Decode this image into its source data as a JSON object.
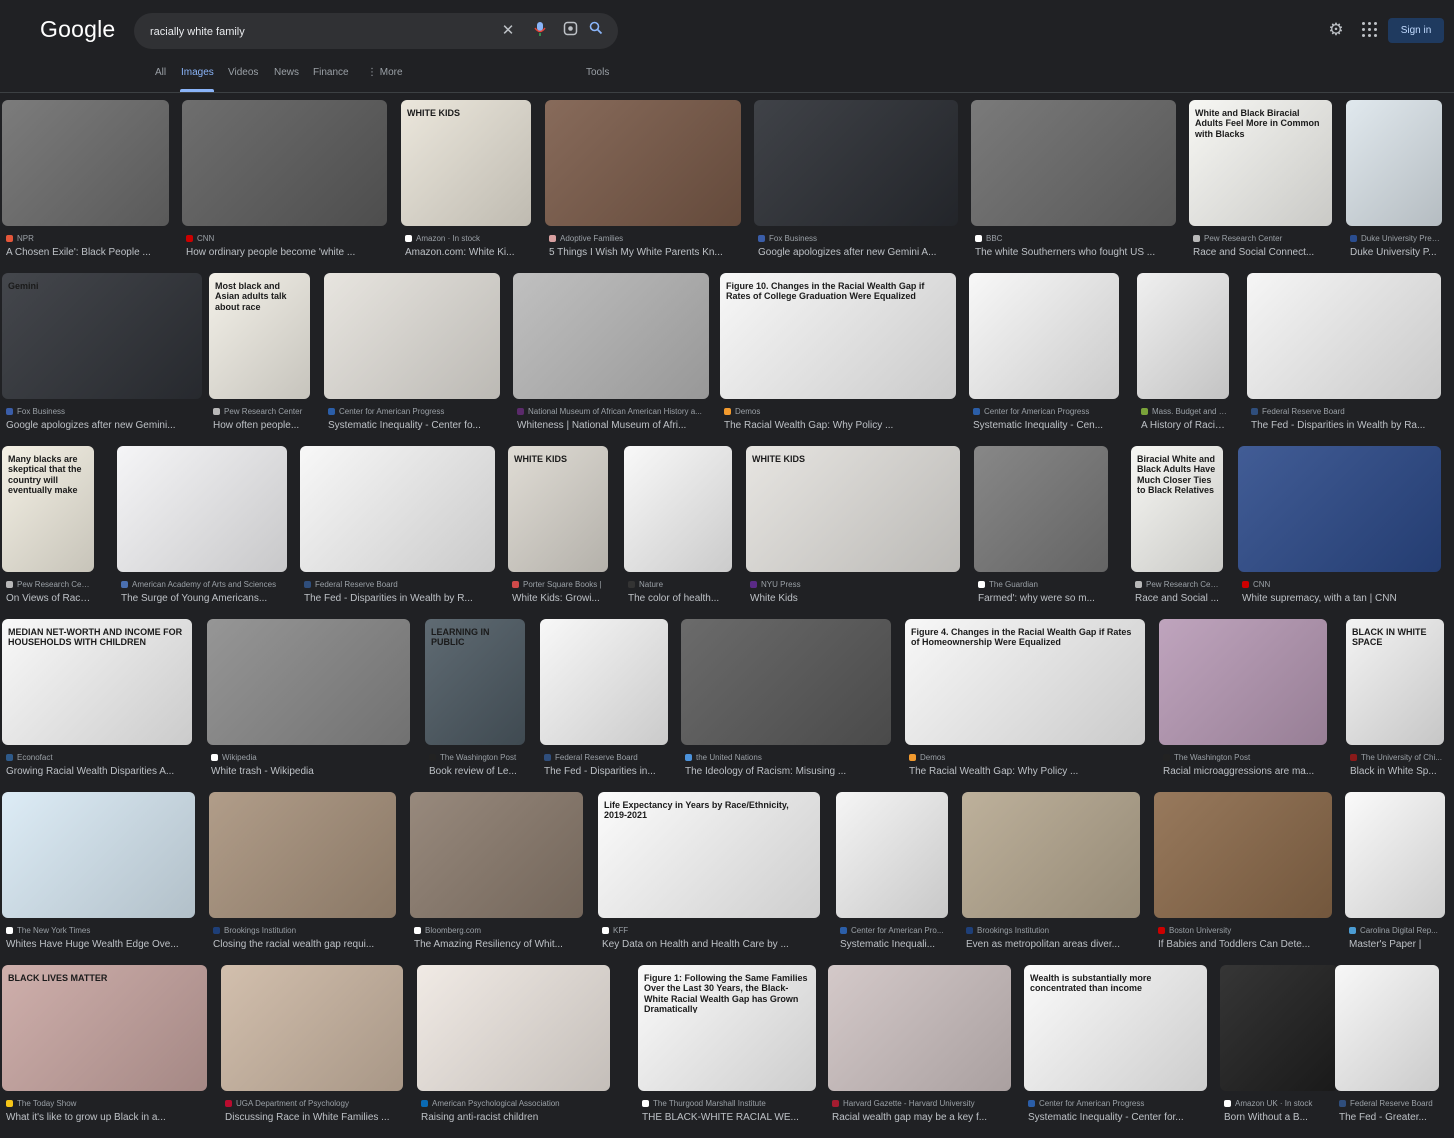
{
  "header": {
    "logo": "Google",
    "query": "racially white family",
    "signin": "Sign in"
  },
  "icons": [
    "clear-icon",
    "mic-icon",
    "lens-icon",
    "search-icon",
    "settings-gear-icon",
    "apps-grid-icon"
  ],
  "tabs": [
    {
      "label": "All"
    },
    {
      "label": "Images",
      "active": true
    },
    {
      "label": "Videos"
    },
    {
      "label": "News"
    },
    {
      "label": "Finance"
    },
    {
      "label": "⋮ More"
    },
    {
      "label": "Tools"
    }
  ],
  "results": [
    {
      "source": "NPR",
      "title": "A Chosen Exile': Black People ...",
      "color": "#6d6d6d",
      "fav": "#e4563a"
    },
    {
      "source": "CNN",
      "title": "How ordinary people become 'white ...",
      "color": "#5e5e5e",
      "fav": "#cc0000"
    },
    {
      "source": "Amazon · In stock",
      "title": "Amazon.com: White Ki...",
      "color": "#e9e4d8",
      "fav": "#ffffff",
      "caption": "WHITE KIDS"
    },
    {
      "source": "Adoptive Families",
      "title": "5 Things I Wish My White Parents Kn...",
      "color": "#7a5a48",
      "fav": "#d8a0a0"
    },
    {
      "source": "Fox Business",
      "title": "Google apologizes after new Gemini A...",
      "color": "#2a2d33",
      "fav": "#3a5da8"
    },
    {
      "source": "BBC",
      "title": "The white Southerners who fought US ...",
      "color": "#6b6b6b",
      "fav": "#ffffff"
    },
    {
      "source": "Pew Research Center",
      "title": "Race and Social Connect...",
      "color": "#f6f6f2",
      "fav": "#b8b8b8",
      "caption": "White and Black Biracial Adults Feel More in Common with Blacks"
    },
    {
      "source": "Duke University Pres...",
      "title": "Duke University P...",
      "color": "#dde6ec",
      "fav": "#2a4d8f"
    },
    {
      "source": "Fox Business",
      "title": "Google apologizes after new Gemini...",
      "color": "#2f3238",
      "fav": "#3a5da8",
      "caption": "Gemini"
    },
    {
      "source": "Pew Research Center",
      "title": "How often people...",
      "color": "#f2efe6",
      "fav": "#b8b8b8",
      "caption": "Most black and Asian adults talk about race"
    },
    {
      "source": "Center for American Progress",
      "title": "Systematic Inequality - Center fo...",
      "color": "#e5e2dc",
      "fav": "#2b5ea8"
    },
    {
      "source": "National Museum of African American History a...",
      "title": "Whiteness | National Museum of Afri...",
      "color": "#b9b9b9",
      "fav": "#5b2a6b"
    },
    {
      "source": "Demos",
      "title": "The Racial Wealth Gap: Why Policy ...",
      "color": "#f7f7f7",
      "fav": "#f29a2e",
      "caption": "Figure 10. Changes in the Racial Wealth Gap if Rates of College Graduation Were Equalized"
    },
    {
      "source": "Center for American Progress",
      "title": "Systematic Inequality - Cen...",
      "color": "#f7f7f7",
      "fav": "#2b5ea8"
    },
    {
      "source": "Mass. Budget and Po...",
      "title": "A History of Racis...",
      "color": "#eeeeee",
      "fav": "#7aa33a"
    },
    {
      "source": "Federal Reserve Board",
      "title": "The Fed - Disparities in Wealth by Ra...",
      "color": "#f5f5f5",
      "fav": "#2f4e7c"
    },
    {
      "source": "Pew Research Center",
      "title": "On Views of Race...",
      "color": "#f3efe2",
      "fav": "#b8b8b8",
      "caption": "Many blacks are skeptical that the country will eventually make the changes necessary for racial equality"
    },
    {
      "source": "American Academy of Arts and Sciences",
      "title": "The Surge of Young Americans...",
      "color": "#f4f4f6",
      "fav": "#4a6fb0"
    },
    {
      "source": "Federal Reserve Board",
      "title": "The Fed - Disparities in Wealth by R...",
      "color": "#f7f7f7",
      "fav": "#2f4e7c"
    },
    {
      "source": "Porter Square Books |",
      "title": "White Kids: Growi...",
      "color": "#dcd8d0",
      "fav": "#d04a4a",
      "caption": "WHITE KIDS"
    },
    {
      "source": "Nature",
      "title": "The color of health...",
      "color": "#f8f8f8",
      "fav": "#333333"
    },
    {
      "source": "NYU Press",
      "title": "White Kids",
      "color": "#e4e2de",
      "fav": "#5a2a86",
      "caption": "WHITE KIDS"
    },
    {
      "source": "The Guardian",
      "title": "Farmed': why were so m...",
      "color": "#7a7a7a",
      "fav": "#ffffff"
    },
    {
      "source": "Pew Research Center",
      "title": "Race and Social ...",
      "color": "#f6f6f2",
      "fav": "#b8b8b8",
      "caption": "Biracial White and Black Adults Have Much Closer Ties to Black Relatives"
    },
    {
      "source": "CNN",
      "title": "White supremacy, with a tan | CNN",
      "color": "#2c4a8a",
      "fav": "#cc0000"
    },
    {
      "source": "Econofact",
      "title": "Growing Racial Wealth Disparities A...",
      "color": "#f8f8f8",
      "fav": "#2e5a8a",
      "caption": "MEDIAN NET-WORTH AND INCOME FOR HOUSEHOLDS WITH CHILDREN"
    },
    {
      "source": "Wikipedia",
      "title": "White trash - Wikipedia",
      "color": "#8a8a8a",
      "fav": "#ffffff"
    },
    {
      "source": "The Washington Post",
      "title": "Book review of Le...",
      "color": "#4d5a63",
      "fav": "#222222",
      "caption": "LEARNING IN PUBLIC"
    },
    {
      "source": "Federal Reserve Board",
      "title": "The Fed - Disparities in...",
      "color": "#f7f7f7",
      "fav": "#2f4e7c"
    },
    {
      "source": "the United Nations",
      "title": "The Ideology of Racism: Misusing ...",
      "color": "#5a5a5a",
      "fav": "#4b92db"
    },
    {
      "source": "Demos",
      "title": "The Racial Wealth Gap: Why Policy ...",
      "color": "#f7f7f7",
      "fav": "#f29a2e",
      "caption": "Figure 4. Changes in the Racial Wealth Gap if Rates of Homeownership Were Equalized"
    },
    {
      "source": "The Washington Post",
      "title": "Racial microaggressions are ma...",
      "color": "#b89ab6",
      "fav": "#222222"
    },
    {
      "source": "The University of Chi...",
      "title": "Black in White Sp...",
      "color": "#f2f2f2",
      "fav": "#8a1a1a",
      "caption": "BLACK IN WHITE SPACE"
    },
    {
      "source": "The New York Times",
      "title": "Whites Have Huge Wealth Edge Ove...",
      "color": "#d9eaf5",
      "fav": "#ffffff"
    },
    {
      "source": "Brookings Institution",
      "title": "Closing the racial wealth gap requi...",
      "color": "#a8927c",
      "fav": "#1e3f78"
    },
    {
      "source": "Bloomberg.com",
      "title": "The Amazing Resiliency of Whit...",
      "color": "#8c7c6e",
      "fav": "#ffffff"
    },
    {
      "source": "KFF",
      "title": "Key Data on Health and Health Care by ...",
      "color": "#fbfbfb",
      "fav": "#ffffff",
      "caption": "Life Expectancy in Years by Race/Ethnicity, 2019-2021"
    },
    {
      "source": "Center for American Pro...",
      "title": "Systematic Inequali...",
      "color": "#f4f4f4",
      "fav": "#2b5ea8"
    },
    {
      "source": "Brookings Institution",
      "title": "Even as metropolitan areas diver...",
      "color": "#b6a890",
      "fav": "#1e3f78"
    },
    {
      "source": "Boston University",
      "title": "If Babies and Toddlers Can Dete...",
      "color": "#8c6a4a",
      "fav": "#cc0000"
    },
    {
      "source": "Carolina Digital Rep...",
      "title": "Master's Paper |",
      "color": "#fafafa",
      "fav": "#4b9cd3"
    },
    {
      "source": "The Today Show",
      "title": "What it's like to grow up Black in a...",
      "color": "#c9a6a2",
      "fav": "#f5c518",
      "caption": "BLACK LIVES MATTER"
    },
    {
      "source": "UGA Department of Psychology",
      "title": "Discussing Race in White Families ...",
      "color": "#cdb8a4",
      "fav": "#ba0c2f"
    },
    {
      "source": "American Psychological Association",
      "title": "Raising anti-racist children",
      "color": "#efe8e2",
      "fav": "#0a6ab4"
    },
    {
      "source": "The Thurgood Marshall Institute",
      "title": "THE BLACK-WHITE RACIAL WE...",
      "color": "#fafafa",
      "fav": "#ffffff",
      "caption": "Figure 1: Following the Same Families Over the Last 30 Years, the Black-White Racial Wealth Gap has Grown Dramatically"
    },
    {
      "source": "Harvard Gazette - Harvard University",
      "title": "Racial wealth gap may be a key f...",
      "color": "#cfc3c3",
      "fav": "#a51c30"
    },
    {
      "source": "Center for American Progress",
      "title": "Systematic Inequality - Center for...",
      "color": "#fafafa",
      "fav": "#2b5ea8",
      "caption": "Wealth is substantially more concentrated than income"
    },
    {
      "source": "Amazon UK · In stock",
      "title": "Born Without a B...",
      "color": "#1f1f1f",
      "fav": "#ffffff"
    },
    {
      "source": "Federal Reserve Board",
      "title": "The Fed - Greater...",
      "color": "#f7f7f7",
      "fav": "#2f4e7c"
    }
  ]
}
